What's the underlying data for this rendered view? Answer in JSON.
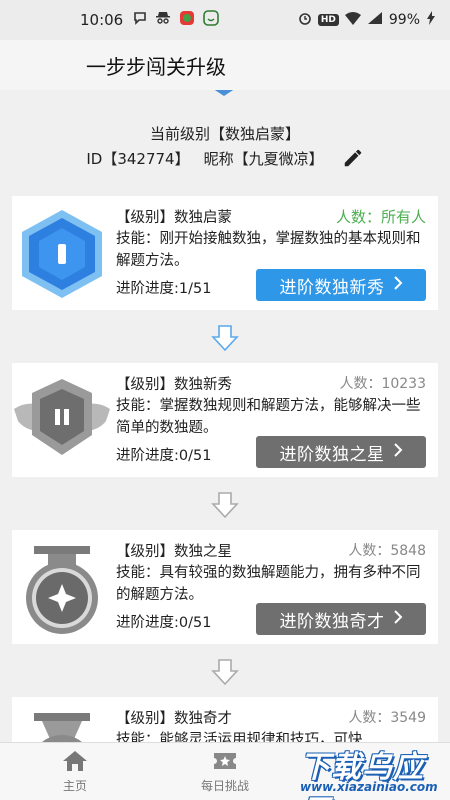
{
  "status_bar": {
    "time": "10:06",
    "signal_label": "4G",
    "battery": "99%",
    "hd": "HD"
  },
  "app_bar": {
    "title": "一步步闯关升级"
  },
  "profile": {
    "level_line": "当前级别【数独启蒙】",
    "id_line": "ID【342774】",
    "nickname_line": "昵称【九夏微凉】"
  },
  "levels": [
    {
      "title": "【级别】数独启蒙",
      "count": "人数：所有人",
      "skill": "技能：刚开始接触数独，掌握数独的基本规则和解题方法。",
      "progress": "进阶进度:1/51",
      "button": "进阶数独新秀",
      "badge_numeral": "I",
      "active": true
    },
    {
      "title": "【级别】数独新秀",
      "count": "人数：10233",
      "skill": "技能：掌握数独规则和解题方法，能够解决一些简单的数独题。",
      "progress": "进阶进度:0/51",
      "button": "进阶数独之星",
      "badge_numeral": "II",
      "active": false
    },
    {
      "title": "【级别】数独之星",
      "count": "人数：5848",
      "skill": "技能：具有较强的数独解题能力，拥有多种不同的解题方法。",
      "progress": "进阶进度:0/51",
      "button": "进阶数独奇才",
      "badge_numeral": "",
      "active": false
    },
    {
      "title": "【级别】数独奇才",
      "count": "人数：3549",
      "skill": "技能：能够灵活运用规律和技巧，可快",
      "progress": "",
      "button": "",
      "badge_numeral": "",
      "active": false
    }
  ],
  "bottom_nav": {
    "home": "主页",
    "daily": "每日挑战"
  },
  "watermark": {
    "big": "下载乌应用",
    "small": "www.xiazainiao.com"
  },
  "colors": {
    "accent_blue": "#2f97e8",
    "button_gray": "#6f6f6f",
    "count_green": "#4caf50"
  }
}
